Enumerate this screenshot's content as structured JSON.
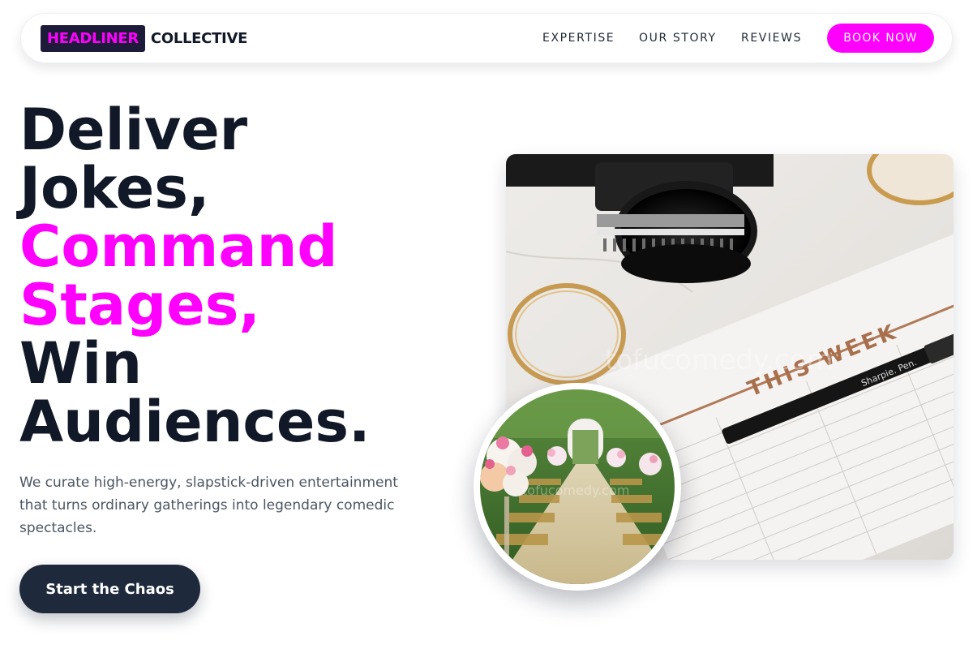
{
  "nav": {
    "logo_highlight": "HEADLINER",
    "logo_rest": "COLLECTIVE",
    "links": [
      {
        "label": "EXPERTISE"
      },
      {
        "label": "OUR STORY"
      },
      {
        "label": "REVIEWS"
      }
    ],
    "book_label": "BOOK NOW"
  },
  "hero": {
    "headline": {
      "line1": "Deliver",
      "line2": "Jokes,",
      "line3": "Command",
      "line4": "Stages,",
      "line5": "Win",
      "line6": "Audiences."
    },
    "subtext": "We curate high-energy, slapstick-driven entertainment that turns ordinary gatherings into legendary comedic spectacles.",
    "cta_label": "Start the Chaos"
  },
  "images": {
    "main_photo": {
      "calendar_text": "THIS WEEK",
      "pen_text": "Sharpie. Pen.",
      "watermark": "tofucomedy.com"
    },
    "circle_photo": {
      "watermark": "tofucomedy.com"
    }
  },
  "colors": {
    "accent": "#ff00ff",
    "dark": "#111827",
    "button_dark": "#1e293b",
    "muted_text": "#4b5563"
  }
}
